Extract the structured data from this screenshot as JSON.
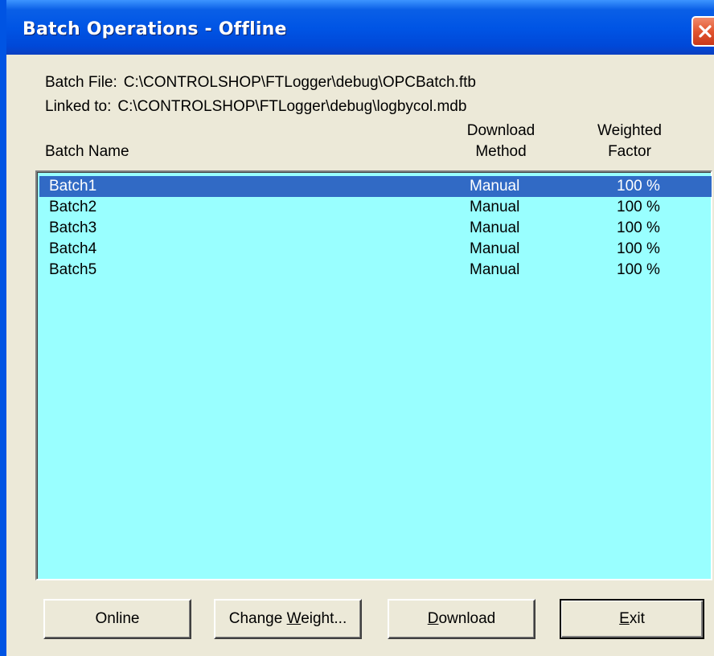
{
  "window": {
    "title": "Batch Operations - Offline",
    "title_color": "#0054e3"
  },
  "info": {
    "batch_file_label": "Batch File:",
    "batch_file_value": "C:\\CONTROLSHOP\\FTLogger\\debug\\OPCBatch.ftb",
    "linked_to_label": "Linked to:",
    "linked_to_value": "C:\\CONTROLSHOP\\FTLogger\\debug\\logbycol.mdb"
  },
  "columns": {
    "name": "Batch Name",
    "method_line1": "Download",
    "method_line2": "Method",
    "factor_line1": "Weighted",
    "factor_line2": "Factor"
  },
  "list": {
    "background": "#99ffff",
    "selected_color": "#316ac5",
    "rows": [
      {
        "name": "Batch1",
        "method": "Manual",
        "factor": "100 %",
        "selected": true
      },
      {
        "name": "Batch2",
        "method": "Manual",
        "factor": "100 %",
        "selected": false
      },
      {
        "name": "Batch3",
        "method": "Manual",
        "factor": "100 %",
        "selected": false
      },
      {
        "name": "Batch4",
        "method": "Manual",
        "factor": "100 %",
        "selected": false
      },
      {
        "name": "Batch5",
        "method": "Manual",
        "factor": "100 %",
        "selected": false
      }
    ]
  },
  "buttons": {
    "online": "Online",
    "change_weight_pre": "Change ",
    "change_weight_u": "W",
    "change_weight_post": "eight...",
    "download_u": "D",
    "download_post": "ownload",
    "exit_u": "E",
    "exit_post": "xit"
  },
  "icons": {
    "close": "close-icon"
  }
}
